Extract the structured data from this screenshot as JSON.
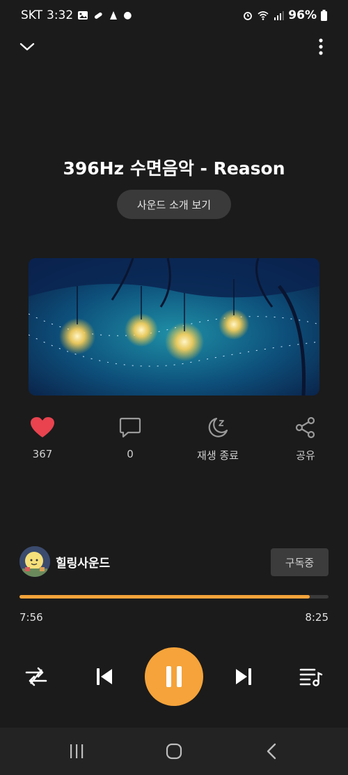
{
  "status_bar": {
    "carrier": "SKT",
    "time": "3:32",
    "battery": "96%"
  },
  "header": {
    "back_icon": "chevron-down-icon",
    "more_icon": "more-vertical-icon"
  },
  "track": {
    "title": "396Hz 수면음악 - Reason",
    "intro_button": "사운드 소개 보기"
  },
  "actions": [
    {
      "icon": "heart-icon",
      "label": "367",
      "color": "#e8434f"
    },
    {
      "icon": "comment-icon",
      "label": "0"
    },
    {
      "icon": "sleep-timer-icon",
      "label": "재생 종료"
    },
    {
      "icon": "share-icon",
      "label": "공유"
    }
  ],
  "channel": {
    "name": "힐링사운드",
    "subscribe_button": "구독중"
  },
  "progress": {
    "current": "7:56",
    "total": "8:25",
    "fraction": 0.94
  },
  "colors": {
    "accent": "#f5a33a",
    "background": "#1b1b1b"
  }
}
